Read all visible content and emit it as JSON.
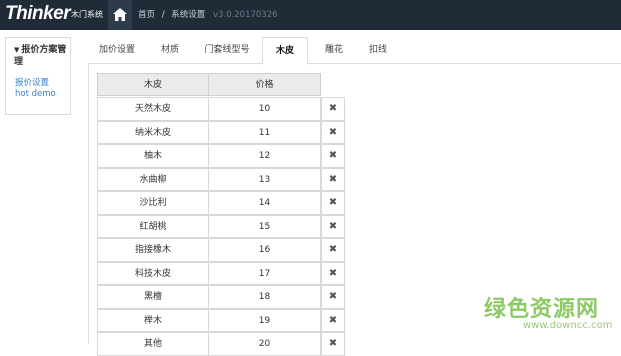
{
  "header": {
    "logo": "Thinker",
    "system_name": "木门系统",
    "breadcrumb": [
      "首页",
      "系统设置"
    ],
    "breadcrumb_sep": "/",
    "version": "v3.0.20170326"
  },
  "sidebar": {
    "title": "报价方案管理",
    "caret": "▼",
    "link_main": "报价设置",
    "link_sub": "hot demo"
  },
  "tabs": [
    {
      "label": "加价设置",
      "active": false
    },
    {
      "label": "材质",
      "active": false
    },
    {
      "label": "门套线型号",
      "active": false
    },
    {
      "label": "木皮",
      "active": true
    },
    {
      "label": "雕花",
      "active": false
    },
    {
      "label": "扣线",
      "active": false
    }
  ],
  "table": {
    "columns": [
      "木皮",
      "价格"
    ],
    "delete_symbol": "✖",
    "rows": [
      {
        "name": "天然木皮",
        "price": "10"
      },
      {
        "name": "纳米木皮",
        "price": "11"
      },
      {
        "name": "柚木",
        "price": "12"
      },
      {
        "name": "水曲柳",
        "price": "13"
      },
      {
        "name": "沙比利",
        "price": "14"
      },
      {
        "name": "红胡桃",
        "price": "15"
      },
      {
        "name": "指接橡木",
        "price": "16"
      },
      {
        "name": "科技木皮",
        "price": "17"
      },
      {
        "name": "黑檀",
        "price": "18"
      },
      {
        "name": "榉木",
        "price": "19"
      },
      {
        "name": "其他",
        "price": "20"
      }
    ]
  },
  "watermark": {
    "text": "绿色资源网",
    "url": "www.downcc.com"
  }
}
